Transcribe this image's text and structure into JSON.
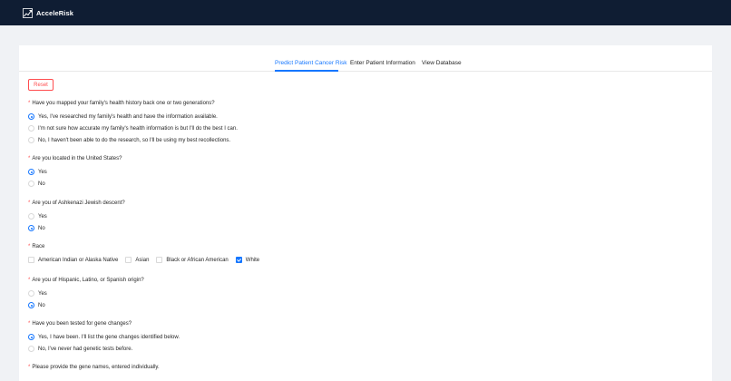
{
  "app": {
    "name": "AcceleRisk"
  },
  "tabs": [
    {
      "label": "Predict Patient Cancer Risk",
      "active": true
    },
    {
      "label": "Enter Patient Information",
      "active": false
    },
    {
      "label": "View Database",
      "active": false
    }
  ],
  "reset_label": "Reset",
  "colors": {
    "header": "#0f1d33",
    "accent": "#1677ff",
    "danger": "#ff4d4f"
  },
  "questions": {
    "family_history": {
      "label": "Have you mapped your family's health history back one or two generations?",
      "options": [
        "Yes, I've researched my family's health and have the information available.",
        "I'm not sure how accurate my family's health information is but I'll do the best I can.",
        "No, I haven't been able to do the research, so I'll be using my best recollections."
      ],
      "selected": 0
    },
    "us_location": {
      "label": "Are you located in the United States?",
      "options": [
        "Yes",
        "No"
      ],
      "selected": 0
    },
    "ashkenazi": {
      "label": "Are you of Ashkenazi Jewish descent?",
      "options": [
        "Yes",
        "No"
      ],
      "selected": 1
    },
    "race": {
      "label": "Race",
      "options": [
        "American Indian or Alaska Native",
        "Asian",
        "Black or African American",
        "White"
      ],
      "checked": [
        false,
        false,
        false,
        true
      ]
    },
    "hispanic": {
      "label": "Are you of Hispanic, Latino, or Spanish origin?",
      "options": [
        "Yes",
        "No"
      ],
      "selected": 1
    },
    "gene_test": {
      "label": "Have you been tested for gene changes?",
      "options": [
        "Yes, I have been. I'll list the gene changes identified below.",
        "No, I've never had genetic tests before."
      ],
      "selected": 0
    },
    "gene_names": {
      "label": "Please provide the gene names, entered individually."
    }
  }
}
